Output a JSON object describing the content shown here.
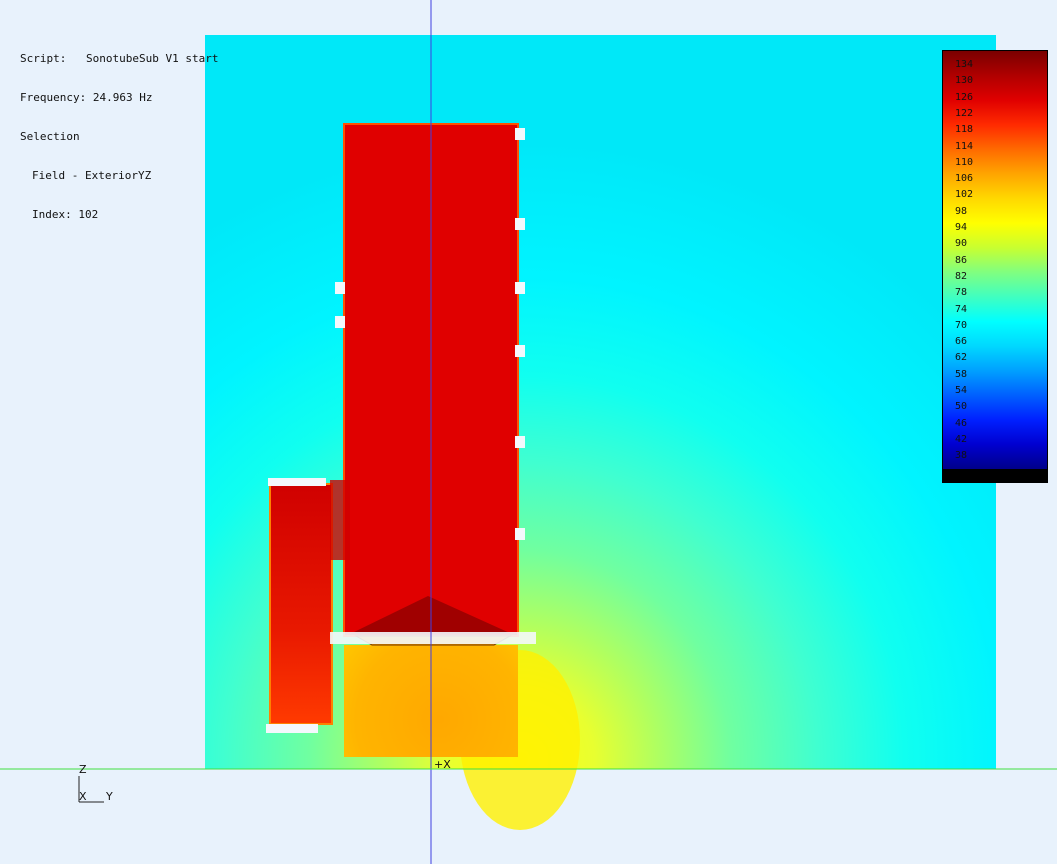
{
  "info": {
    "script_label": "Script:",
    "script_value": "SonotubeSub V1 start",
    "frequency_label": "Frequency:",
    "frequency_value": "24.963 Hz",
    "selection": "Selection",
    "field": "Field - ExteriorYZ",
    "index": "Index: 102"
  },
  "legend": {
    "ticks": [
      "134",
      "130",
      "126",
      "122",
      "118",
      "114",
      "110",
      "106",
      "102",
      "98",
      "94",
      "90",
      "86",
      "82",
      "78",
      "74",
      "70",
      "66",
      "62",
      "58",
      "54",
      "50",
      "46",
      "42",
      "38"
    ],
    "colors": [
      "#7a0000",
      "#b00000",
      "#e00000",
      "#ff2a00",
      "#ff6a00",
      "#ffa500",
      "#ffd800",
      "#ffff00",
      "#c8ff30",
      "#80ff80",
      "#40ffc0",
      "#00ffff",
      "#00d8ff",
      "#00a0ff",
      "#0060ff",
      "#0020ff",
      "#0000d0",
      "#00008a"
    ]
  },
  "axes": {
    "z_label": "Z",
    "x_label": "X",
    "y_label": "Y",
    "origin_label": "+X"
  },
  "colors": {
    "background": "#e8f2fc",
    "field_far": "#00ffff",
    "enclosure": "#e00000",
    "vertical_axis": "#4040e0",
    "ground_line": "#40e040"
  }
}
